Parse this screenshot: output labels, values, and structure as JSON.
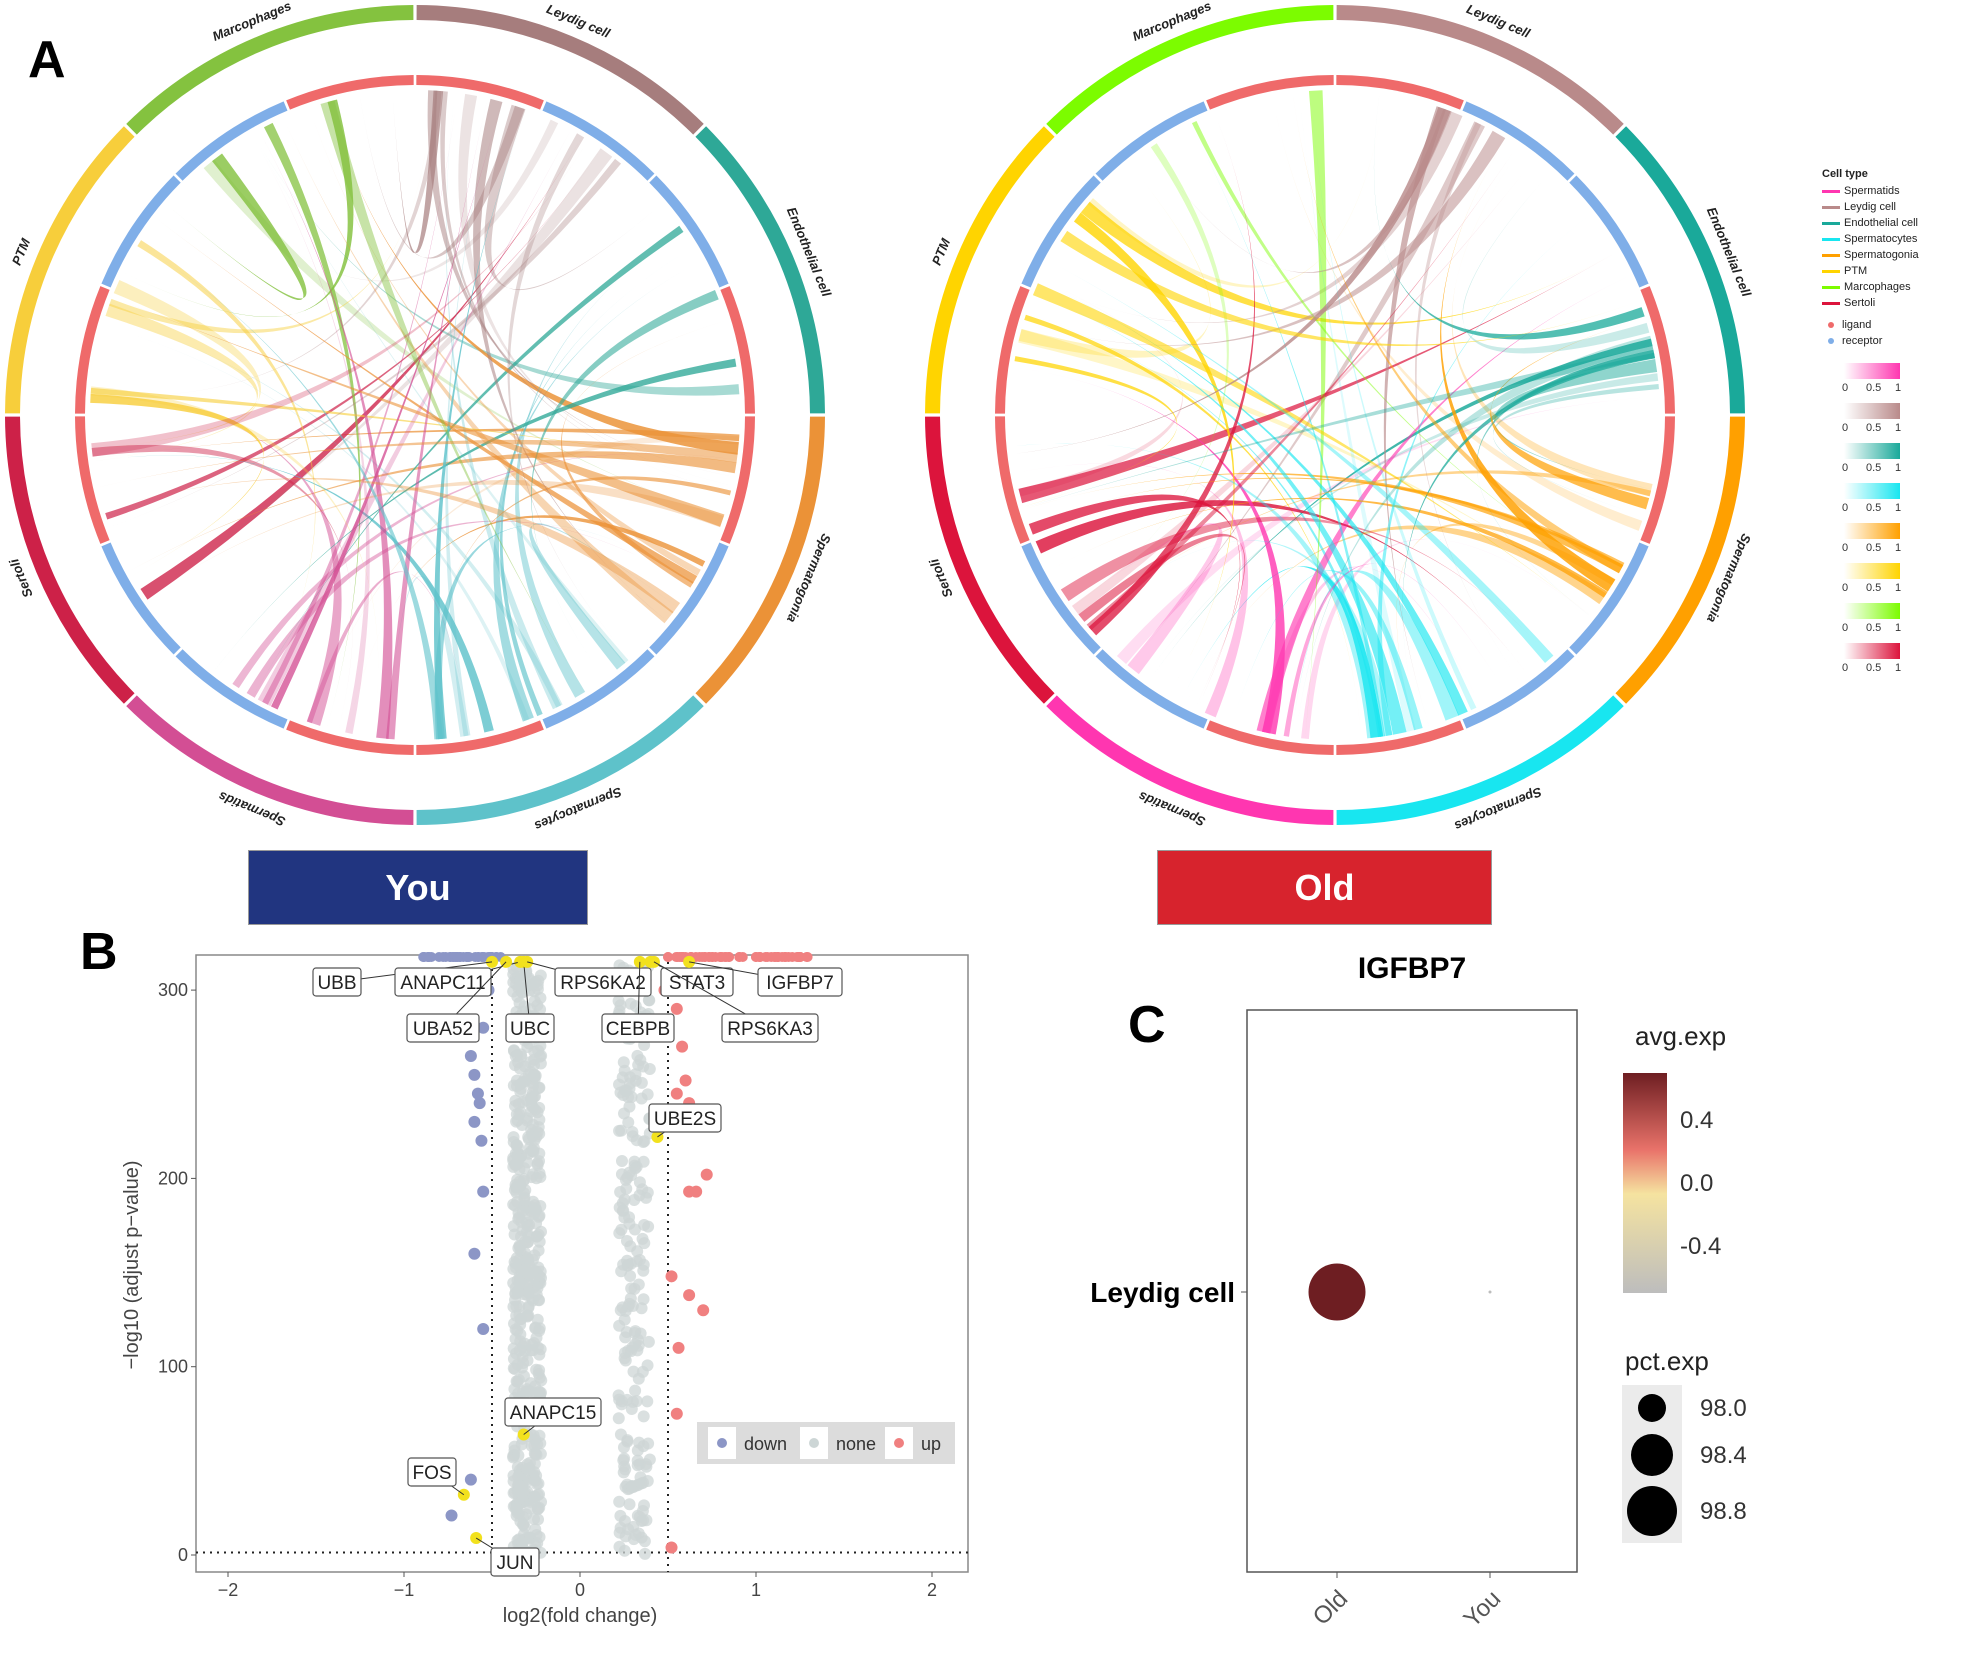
{
  "panels": {
    "a": "A",
    "b": "B",
    "c": "C"
  },
  "groups": {
    "young": {
      "label": "You",
      "color": "#213580"
    },
    "old": {
      "label": "Old",
      "color": "#D7232D"
    }
  },
  "chart_data": [
    {
      "type": "chord",
      "panel": "A",
      "group": "You",
      "sectors": [
        {
          "name": "Leydig cell",
          "color": "#A67D7D"
        },
        {
          "name": "Endothelial cell",
          "color": "#2EA897"
        },
        {
          "name": "Spermatogonia",
          "color": "#EB9237"
        },
        {
          "name": "Spermatocytes",
          "color": "#5EC2CA"
        },
        {
          "name": "Spermatids",
          "color": "#D34E94"
        },
        {
          "name": "Sertoli",
          "color": "#CD2148"
        },
        {
          "name": "PTM",
          "color": "#F7CE3B"
        },
        {
          "name": "Marcophages",
          "color": "#84C23F"
        }
      ]
    },
    {
      "type": "chord",
      "panel": "A",
      "group": "Old",
      "sectors": [
        {
          "name": "Leydig cell",
          "color": "#B98A8A"
        },
        {
          "name": "Endothelial cell",
          "color": "#1AA99A"
        },
        {
          "name": "Spermatogonia",
          "color": "#FFA000"
        },
        {
          "name": "Spermatocytes",
          "color": "#18E6F0"
        },
        {
          "name": "Spermatids",
          "color": "#FF36B0"
        },
        {
          "name": "Sertoli",
          "color": "#DC143C"
        },
        {
          "name": "PTM",
          "color": "#FFD400"
        },
        {
          "name": "Marcophages",
          "color": "#7CFC00"
        }
      ]
    },
    {
      "type": "scatter",
      "panel": "B",
      "title": "",
      "xlabel": "log2(fold change)",
      "ylabel": "-log10 (adjust p-value)",
      "xlim": [
        -2.2,
        2.2
      ],
      "ylim": [
        -5,
        315
      ],
      "xticks": [
        -2,
        -1,
        0,
        1,
        2
      ],
      "yticks": [
        0,
        100,
        200,
        300
      ],
      "thresholds": {
        "x": [
          -0.5,
          0.5
        ],
        "y": 1.3
      },
      "legend": {
        "position": "bottom-right",
        "entries": [
          {
            "label": "down",
            "color": "#8C96C6"
          },
          {
            "label": "none",
            "color": "#CDD6D6"
          },
          {
            "label": "up",
            "color": "#F08080"
          }
        ]
      },
      "highlight_color": "#F2E11D",
      "labeled_genes": [
        {
          "gene": "UBB",
          "x": -0.5,
          "y": 315
        },
        {
          "gene": "ANAPC11",
          "x": -0.34,
          "y": 315
        },
        {
          "gene": "UBA52",
          "x": -0.42,
          "y": 315
        },
        {
          "gene": "UBC",
          "x": -0.32,
          "y": 315
        },
        {
          "gene": "RPS6KA2",
          "x": -0.3,
          "y": 315
        },
        {
          "gene": "STAT3",
          "x": 0.4,
          "y": 315
        },
        {
          "gene": "CEBPB",
          "x": 0.34,
          "y": 315
        },
        {
          "gene": "IGFBP7",
          "x": 0.62,
          "y": 315
        },
        {
          "gene": "RPS6KA3",
          "x": 0.42,
          "y": 315
        },
        {
          "gene": "UBE2S",
          "x": 0.44,
          "y": 222
        },
        {
          "gene": "ANAPC15",
          "x": -0.32,
          "y": 64
        },
        {
          "gene": "FOS",
          "x": -0.66,
          "y": 32
        },
        {
          "gene": "JUN",
          "x": -0.59,
          "y": 9
        }
      ],
      "down_points": [
        {
          "x": -0.62,
          "y": 265
        },
        {
          "x": -0.6,
          "y": 255
        },
        {
          "x": -0.58,
          "y": 245
        },
        {
          "x": -0.57,
          "y": 240
        },
        {
          "x": -0.6,
          "y": 230
        },
        {
          "x": -0.56,
          "y": 220
        },
        {
          "x": -0.55,
          "y": 193
        },
        {
          "x": -0.6,
          "y": 160
        },
        {
          "x": -0.55,
          "y": 120
        },
        {
          "x": -0.62,
          "y": 40
        },
        {
          "x": -0.73,
          "y": 21
        },
        {
          "x": -0.55,
          "y": 280
        },
        {
          "x": -0.52,
          "y": 300
        }
      ],
      "up_points": [
        {
          "x": 0.48,
          "y": 300
        },
        {
          "x": 0.55,
          "y": 290
        },
        {
          "x": 0.58,
          "y": 270
        },
        {
          "x": 0.6,
          "y": 252
        },
        {
          "x": 0.55,
          "y": 245
        },
        {
          "x": 0.62,
          "y": 240
        },
        {
          "x": 0.5,
          "y": 235
        },
        {
          "x": 0.57,
          "y": 232
        },
        {
          "x": 0.72,
          "y": 202
        },
        {
          "x": 0.62,
          "y": 193
        },
        {
          "x": 0.66,
          "y": 193
        },
        {
          "x": 0.52,
          "y": 148
        },
        {
          "x": 0.62,
          "y": 138
        },
        {
          "x": 0.7,
          "y": 130
        },
        {
          "x": 0.56,
          "y": 110
        },
        {
          "x": 0.55,
          "y": 75
        },
        {
          "x": 0.52,
          "y": 4
        }
      ]
    },
    {
      "type": "dot",
      "panel": "C",
      "title": "IGFBP7",
      "categories": [
        "Old",
        "You"
      ],
      "rows": [
        "Leydig cell"
      ],
      "points": [
        {
          "row": "Leydig cell",
          "group": "Old",
          "avg_exp": 0.7,
          "pct_exp": 98.9
        },
        {
          "row": "Leydig cell",
          "group": "You",
          "avg_exp": -0.7,
          "pct_exp": 97.0
        }
      ],
      "color_legend": {
        "title": "avg.exp",
        "ticks": [
          0.4,
          0.0,
          -0.4
        ],
        "range": [
          -0.7,
          0.7
        ],
        "low": "#BDBDBD",
        "mid": "#F5E3A0",
        "high": "#6E1E22"
      },
      "size_legend": {
        "title": "pct.exp",
        "ticks": [
          98.0,
          98.4,
          98.8
        ]
      }
    }
  ],
  "legend_a": {
    "title": "Cell type",
    "cell_types": [
      {
        "name": "Spermatids",
        "color": "#FF36B0"
      },
      {
        "name": "Leydig cell",
        "color": "#B98A8A"
      },
      {
        "name": "Endothelial cell",
        "color": "#1AA99A"
      },
      {
        "name": "Spermatocytes",
        "color": "#18E6F0"
      },
      {
        "name": "Spermatogonia",
        "color": "#FFA000"
      },
      {
        "name": "PTM",
        "color": "#FFD400"
      },
      {
        "name": "Marcophages",
        "color": "#7CFC00"
      },
      {
        "name": "Sertoli",
        "color": "#DC143C"
      }
    ],
    "roles": [
      {
        "name": "ligand",
        "color": "#EF6A6A"
      },
      {
        "name": "receptor",
        "color": "#7FAEE8"
      }
    ],
    "scale_ticks": [
      "0",
      "0.5",
      "1"
    ]
  }
}
